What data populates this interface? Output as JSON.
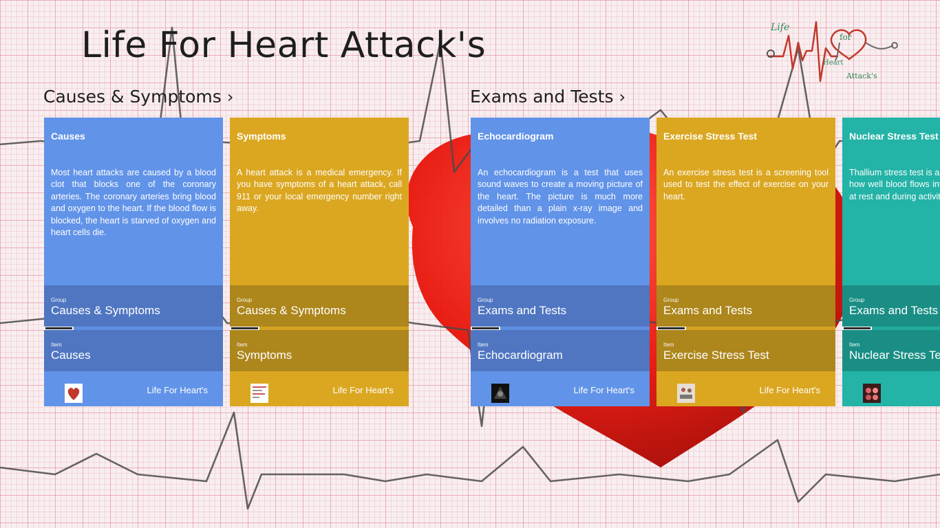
{
  "app": {
    "title": "Life For Heart Attack's"
  },
  "logo": {
    "life": "Life",
    "for": "for",
    "heart": "Heart",
    "attacks": "Attack's"
  },
  "groups": [
    {
      "header": "Causes & Symptoms",
      "chevron": "›"
    },
    {
      "header": "Exams and Tests",
      "chevron": "›"
    }
  ],
  "labels": {
    "group": "Group",
    "item": "Item"
  },
  "tiles": [
    {
      "title": "Causes",
      "description": "Most heart attacks are caused by a blood clot that blocks one of the coronary arteries. The coronary arteries bring blood and oxygen to the heart. If the blood flow is blocked, the heart is starved of oxygen and heart cells die.",
      "group": "Causes & Symptoms",
      "item": "Causes",
      "brand": "Life For Heart's",
      "color": "#6193e8"
    },
    {
      "title": "Symptoms",
      "description": "A heart attack is a medical emergency. If you have symptoms of a heart attack, call 911 or your local emergency number right away.",
      "group": "Causes & Symptoms",
      "item": "Symptoms",
      "brand": "Life For Heart's",
      "color": "#dba721"
    },
    {
      "title": "Echocardiogram",
      "description": "An echocardiogram is a test that uses sound waves to create a moving picture of the heart. The picture is much more detailed than a plain x-ray image and involves no radiation exposure.",
      "group": "Exams and Tests",
      "item": "Echocardiogram",
      "brand": "Life For Heart's",
      "color": "#6193e8"
    },
    {
      "title": "Exercise Stress Test",
      "description": "An exercise stress test is a screening tool used to test the effect of exercise on your heart.",
      "group": "Exams and Tests",
      "item": "Exercise Stress Test",
      "brand": "Life For Heart's",
      "color": "#dba721"
    },
    {
      "title": "Nuclear Stress Test",
      "description": "Thallium stress test is a method that shows how well blood flows into the heart muscle at rest and during activity.",
      "group": "Exams and Tests",
      "item": "Nuclear Stress Test",
      "brand": "",
      "color": "#23b3a7"
    }
  ]
}
